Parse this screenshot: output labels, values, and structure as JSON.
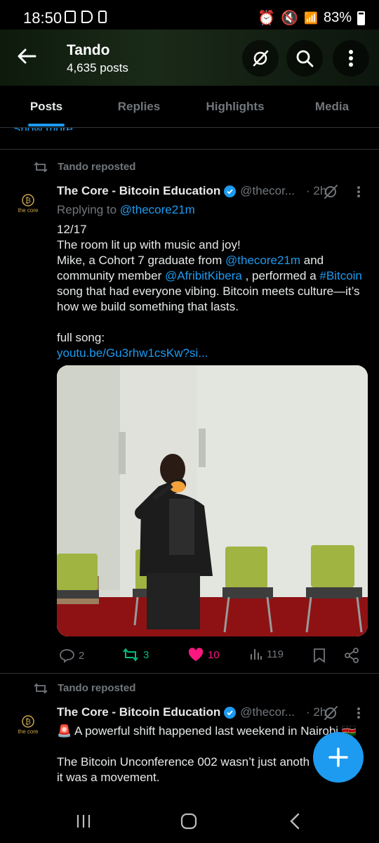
{
  "status": {
    "time": "18:50",
    "battery": "83%"
  },
  "header": {
    "title": "Tando",
    "subtitle": "4,635 posts"
  },
  "tabs": [
    {
      "label": "Posts"
    },
    {
      "label": "Replies"
    },
    {
      "label": "Highlights"
    },
    {
      "label": "Media"
    }
  ],
  "show_more": "Show more",
  "tweets": [
    {
      "repost_label": "Tando reposted",
      "author_name": "The Core - Bitcoin Education",
      "handle": "@thecor...",
      "time": "· 2h",
      "avatar_label": "the core",
      "replying_prefix": "Replying to ",
      "replying_to": "@thecore21m",
      "lines": {
        "l1": "12/17",
        "l2": "The room lit up with music and joy!",
        "l3a": "Mike, a Cohort 7 graduate from ",
        "l3b": "@thecore21m",
        "l3c": " and",
        "l4a": "community member ",
        "l4b": "@AfribitKibera",
        "l4c": " , performed a ",
        "l4d": "#Bitcoin",
        "l5": "song that had everyone vibing. Bitcoin meets culture—it’s",
        "l6": "how we build something that lasts.",
        "l7": "full song:",
        "l8": "youtu.be/Gu3rhw1csKw?si..."
      },
      "actions": {
        "replies": "2",
        "reposts": "3",
        "likes": "10",
        "views": "119"
      }
    },
    {
      "repost_label": "Tando reposted",
      "author_name": "The Core - Bitcoin Education",
      "handle": "@thecor...",
      "time": "· 2h",
      "avatar_label": "the core",
      "lines": {
        "l1": "🚨 A powerful shift happened last weekend in Nairobi 🇰🇪",
        "l2": "The Bitcoin Unconference 002 wasn’t just anoth",
        "l3": "it was a movement."
      }
    }
  ],
  "colors": {
    "accent": "#1d9bf0",
    "repost_green": "#00ba7c",
    "like_pink": "#f91880",
    "muted": "#71767b"
  }
}
